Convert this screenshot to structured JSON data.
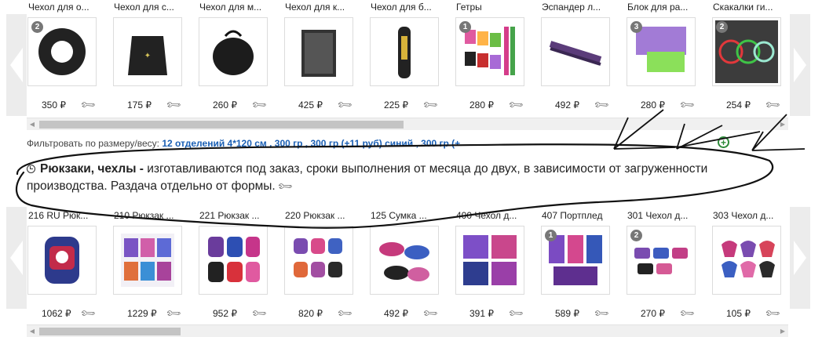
{
  "top_row": {
    "items": [
      {
        "title": "Чехол для о...",
        "price": "350 ₽",
        "badge": "2",
        "icon": "ring-case-image"
      },
      {
        "title": "Чехол для с...",
        "price": "175 ₽",
        "badge": "",
        "icon": "drawstring-bag-image"
      },
      {
        "title": "Чехол для м...",
        "price": "260 ₽",
        "badge": "",
        "icon": "ball-bag-image"
      },
      {
        "title": "Чехол для к...",
        "price": "425 ₽",
        "badge": "",
        "icon": "garment-cover-image"
      },
      {
        "title": "Чехол для б...",
        "price": "225 ₽",
        "badge": "",
        "icon": "club-case-image"
      },
      {
        "title": "Гетры",
        "price": "280 ₽",
        "badge": "1",
        "icon": "leg-warmers-image"
      },
      {
        "title": "Эспандер л...",
        "price": "492 ₽",
        "badge": "",
        "icon": "stretch-band-image"
      },
      {
        "title": "Блок для ра...",
        "price": "280 ₽",
        "badge": "3",
        "icon": "yoga-block-image"
      },
      {
        "title": "Скакалки ги...",
        "price": "254 ₽",
        "badge": "2",
        "icon": "jump-rope-image"
      }
    ]
  },
  "filter": {
    "label": "Фильтровать по размеру/весу:",
    "links": "12 отделений 4*120 см , 300 гр , 300 гр (+11 руб) синий , 300 гр (+"
  },
  "note": {
    "bold": "Рюкзаки, чехлы -",
    "text": " изготавливаются под заказ, сроки выполнения от месяца до двух, в зависимости от загруженности производства. Раздача отдельно от формы."
  },
  "bottom_row": {
    "items": [
      {
        "title": "216 RU Рюк...",
        "price": "1062 ₽",
        "badge": "",
        "icon": "backpack-image"
      },
      {
        "title": "210 Рюкзак ...",
        "price": "1229 ₽",
        "badge": "",
        "icon": "backpack-catalog-image"
      },
      {
        "title": "221 Рюкзак ...",
        "price": "952 ₽",
        "badge": "",
        "icon": "backpack-set-image"
      },
      {
        "title": "220 Рюкзак ...",
        "price": "820 ₽",
        "badge": "",
        "icon": "small-backpack-image"
      },
      {
        "title": "125 Сумка ...",
        "price": "492 ₽",
        "badge": "",
        "icon": "shoe-bag-image"
      },
      {
        "title": "400 Чехол д...",
        "price": "391 ₽",
        "badge": "",
        "icon": "case-set-image"
      },
      {
        "title": "407 Портплед",
        "price": "589 ₽",
        "badge": "1",
        "icon": "garment-bag-image"
      },
      {
        "title": "301 Чехол д...",
        "price": "270 ₽",
        "badge": "2",
        "icon": "pouch-set-image"
      },
      {
        "title": "303 Чехол д...",
        "price": "105 ₽",
        "badge": "",
        "icon": "toe-cover-image"
      }
    ]
  },
  "colors": {
    "link": "#1a5fb4",
    "scribble": "#111111",
    "zoom": "#2e8b3a"
  }
}
